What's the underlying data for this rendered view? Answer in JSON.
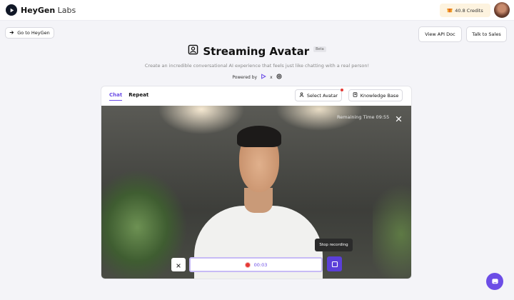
{
  "app": {
    "name_bold": "HeyGen",
    "name_light": " Labs"
  },
  "header": {
    "credits": "40.8 Credits"
  },
  "nav": {
    "goto_label": "Go to HeyGen",
    "api_doc_label": "View API Doc",
    "sales_label": "Talk to Sales"
  },
  "hero": {
    "title": "Streaming Avatar",
    "badge": "Beta",
    "subtitle": "Create an incredible conversational AI experience that feels just like chatting with a real person!",
    "powered_by": "Powered by",
    "powered_sep": "x"
  },
  "panel": {
    "tabs": [
      {
        "label": "Chat",
        "active": true
      },
      {
        "label": "Repeat",
        "active": false
      }
    ],
    "select_avatar_label": "Select Avatar",
    "knowledge_base_label": "Knowledge Base"
  },
  "video": {
    "remaining_time": "Remaining Time 09:55",
    "recording_time": "00:03",
    "tooltip": "Stop recording"
  },
  "colors": {
    "accent": "#6c4de6",
    "record": "#e53935",
    "credits_bg": "#fdf3df"
  }
}
